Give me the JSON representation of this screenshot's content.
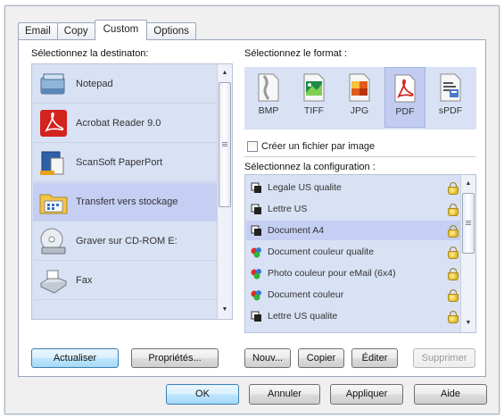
{
  "tabs": [
    "Email",
    "Copy",
    "Custom",
    "Options"
  ],
  "active_tab": "Custom",
  "destination": {
    "label": "Sélectionnez la destinaton:",
    "items": [
      {
        "label": "Notepad",
        "icon": "notepad-icon"
      },
      {
        "label": "Acrobat Reader 9.0",
        "icon": "acrobat-icon"
      },
      {
        "label": "ScanSoft PaperPort",
        "icon": "paperport-icon"
      },
      {
        "label": "Transfert vers stockage",
        "icon": "storage-transfer-icon",
        "selected": true
      },
      {
        "label": "Graver sur CD-ROM  E:",
        "icon": "cd-burn-icon"
      },
      {
        "label": "Fax",
        "icon": "fax-icon"
      }
    ]
  },
  "format": {
    "label": "Sélectionnez le format :",
    "options": [
      {
        "label": "BMP",
        "icon": "bmp-icon"
      },
      {
        "label": "TIFF",
        "icon": "tiff-icon"
      },
      {
        "label": "JPG",
        "icon": "jpg-icon"
      },
      {
        "label": "PDF",
        "icon": "pdf-icon",
        "selected": true
      },
      {
        "label": "sPDF",
        "icon": "spdf-icon"
      }
    ],
    "checkbox_label": "Créer un fichier par image",
    "checkbox_checked": false
  },
  "configuration": {
    "label": "Sélectionnez la configuration :",
    "items": [
      {
        "label": "Legale US qualite",
        "color": "bw"
      },
      {
        "label": "Lettre US",
        "color": "bw"
      },
      {
        "label": "Document A4",
        "color": "bw",
        "selected": true
      },
      {
        "label": "Document couleur qualite",
        "color": "color"
      },
      {
        "label": "Photo couleur pour eMail (6x4)",
        "color": "color"
      },
      {
        "label": "Document couleur",
        "color": "color"
      },
      {
        "label": "Lettre US qualite",
        "color": "bw"
      }
    ]
  },
  "buttons": {
    "refresh": "Actualiser",
    "properties": "Propriétés...",
    "new": "Nouv...",
    "copy": "Copier",
    "edit": "Éditer",
    "delete": "Supprimer",
    "ok": "OK",
    "cancel": "Annuler",
    "apply": "Appliquer",
    "help": "Aide"
  },
  "colors": {
    "list_bg": "#d9e1f4",
    "selection": "#c5cff3",
    "pdf_red": "#d2231e"
  }
}
